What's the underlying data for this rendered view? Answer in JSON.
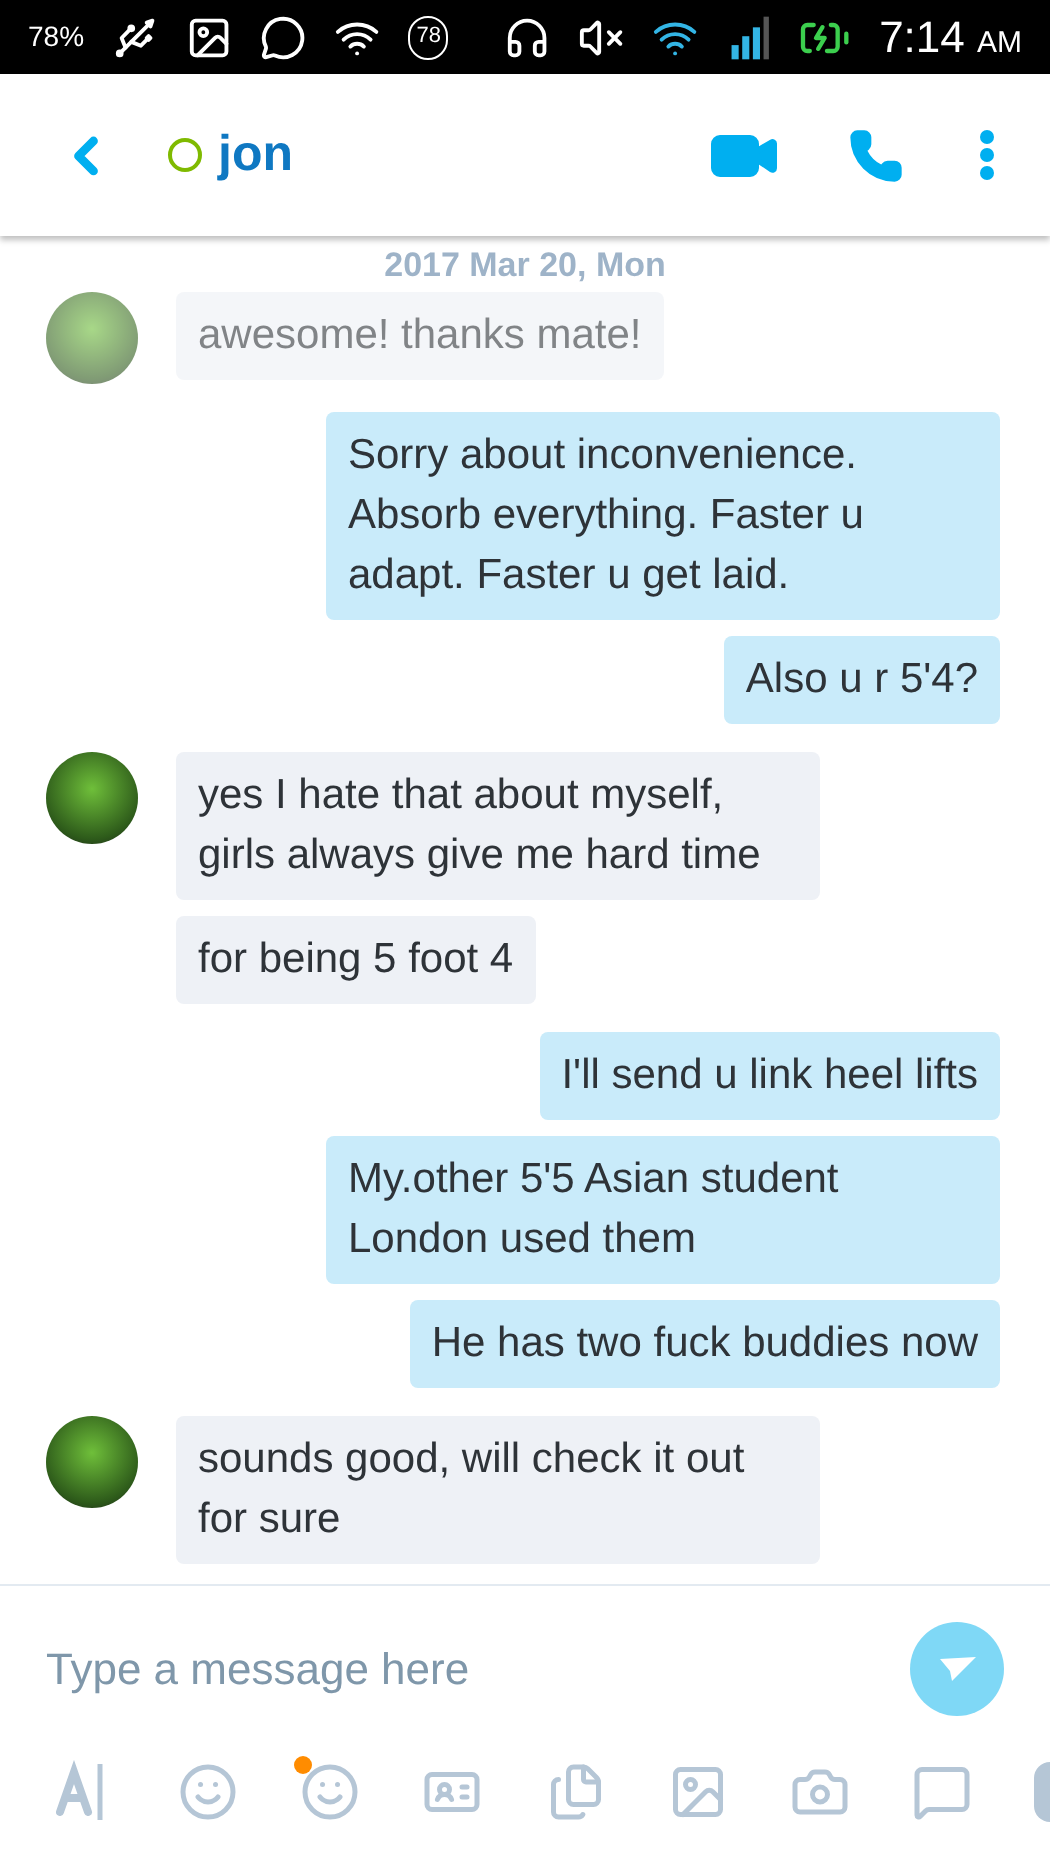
{
  "status_bar": {
    "battery_percent": "78%",
    "battery_badge": "78",
    "time": "7:14",
    "meridiem": "AM"
  },
  "header": {
    "contact": "jon"
  },
  "date_divider": "2017 Mar 20, Mon",
  "messages": [
    {
      "kind": "incoming",
      "avatar": true,
      "faded": true,
      "text": "awesome! thanks mate!"
    },
    {
      "kind": "outgoing",
      "text": "Sorry about inconvenience. Absorb everything. Faster u adapt. Faster u get laid."
    },
    {
      "kind": "outgoing",
      "text": "Also u r 5'4?"
    },
    {
      "kind": "incoming",
      "avatar": true,
      "faded": false,
      "text": "yes I hate that about myself, girls always give me hard time"
    },
    {
      "kind": "incoming",
      "avatar": false,
      "faded": false,
      "text": "for being 5 foot 4"
    },
    {
      "kind": "outgoing",
      "text": "I'll send u link heel lifts"
    },
    {
      "kind": "outgoing",
      "text": "My.other 5'5 Asian student London used them"
    },
    {
      "kind": "outgoing",
      "text": "He has two fuck buddies now"
    },
    {
      "kind": "incoming",
      "avatar": true,
      "faded": false,
      "text": "sounds good, will check it out for sure"
    }
  ],
  "composer": {
    "placeholder": "Type a message here"
  },
  "toolbar": {
    "stickers_new": true
  }
}
